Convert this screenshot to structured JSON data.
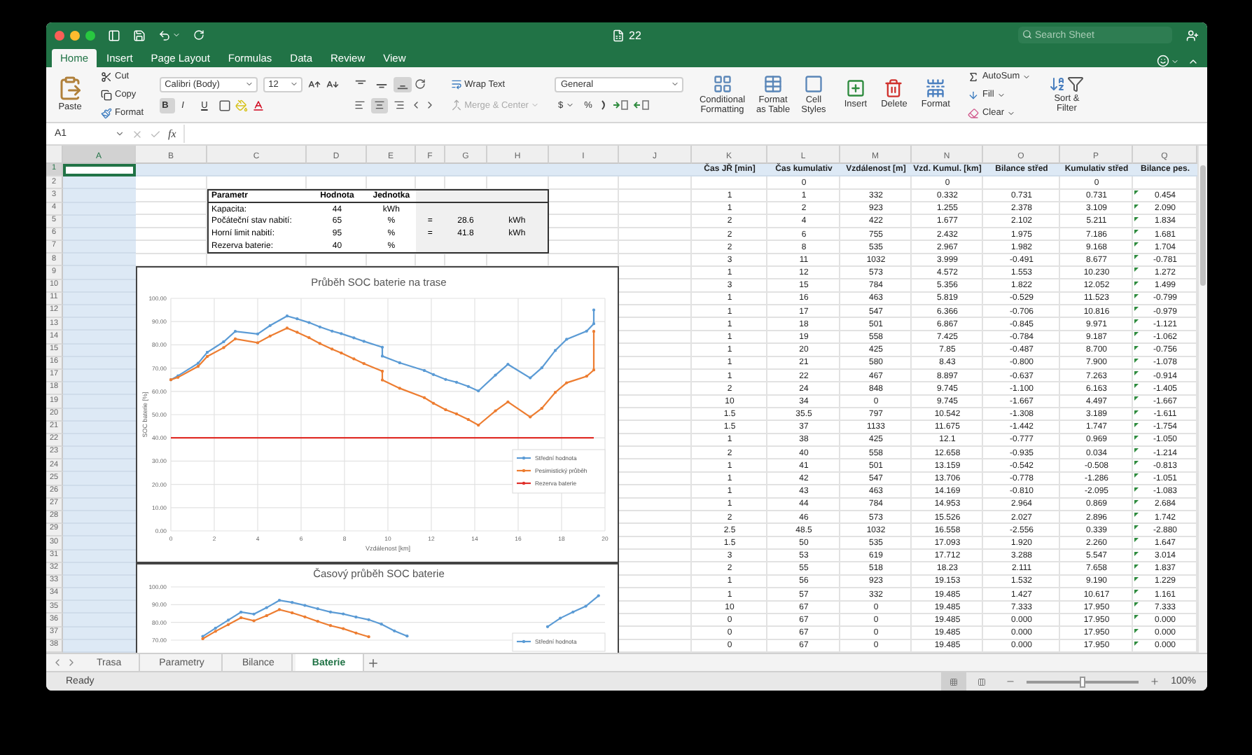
{
  "window": {
    "title": "22",
    "search": {
      "placeholder": "Search Sheet"
    }
  },
  "ribbon_tabs": [
    {
      "label": "Home",
      "selected": true
    },
    {
      "label": "Insert",
      "selected": false
    },
    {
      "label": "Page Layout",
      "selected": false
    },
    {
      "label": "Formulas",
      "selected": false
    },
    {
      "label": "Data",
      "selected": false
    },
    {
      "label": "Review",
      "selected": false
    },
    {
      "label": "View",
      "selected": false
    }
  ],
  "clipboard": {
    "paste": "Paste",
    "cut": "Cut",
    "copy": "Copy",
    "format": "Format"
  },
  "font": {
    "name": "Calibri (Body)",
    "size": "12",
    "styles": [
      {
        "kind": "bold",
        "label": "B",
        "pressed": true
      },
      {
        "kind": "italic",
        "label": "I",
        "pressed": false
      },
      {
        "kind": "underline",
        "label": "U",
        "pressed": false
      }
    ]
  },
  "alignment": {
    "vertical": [
      {
        "kind": "top",
        "selected": false
      },
      {
        "kind": "middle",
        "selected": false
      },
      {
        "kind": "bottom",
        "selected": true
      }
    ],
    "horizontal": [
      {
        "kind": "left",
        "selected": false
      },
      {
        "kind": "center",
        "selected": true
      },
      {
        "kind": "right",
        "selected": false
      }
    ],
    "wrap_text": "Wrap Text",
    "merge": {
      "label": "Merge & Center",
      "disabled": true
    }
  },
  "number": {
    "format": "General",
    "currency": "$",
    "percent": "%"
  },
  "styles": [
    {
      "kind": "conditional",
      "lines": [
        "Conditional",
        "Formatting"
      ]
    },
    {
      "kind": "table",
      "lines": [
        "Format",
        "as Table"
      ]
    },
    {
      "kind": "cell",
      "lines": [
        "Cell",
        "Styles"
      ]
    }
  ],
  "cells": [
    {
      "kind": "insert",
      "label": "Insert"
    },
    {
      "kind": "delete",
      "label": "Delete"
    },
    {
      "kind": "format",
      "label": "Format"
    }
  ],
  "editing": {
    "autosum": "AutoSum",
    "fill": "Fill",
    "clear": "Clear",
    "sort": [
      "Sort &",
      "Filter"
    ]
  },
  "formula_bar": {
    "name_box": "A1",
    "function_label": "fx"
  },
  "columns": [
    {
      "label": "A",
      "selected": true
    },
    {
      "label": "B",
      "selected": false
    },
    {
      "label": "C",
      "selected": false
    },
    {
      "label": "D",
      "selected": false
    },
    {
      "label": "E",
      "selected": false
    },
    {
      "label": "F",
      "selected": false
    },
    {
      "label": "G",
      "selected": false
    },
    {
      "label": "H",
      "selected": false
    },
    {
      "label": "I",
      "selected": false
    },
    {
      "label": "J",
      "selected": false
    },
    {
      "label": "K",
      "selected": false
    },
    {
      "label": "L",
      "selected": false
    },
    {
      "label": "M",
      "selected": false
    },
    {
      "label": "N",
      "selected": false
    },
    {
      "label": "O",
      "selected": false
    },
    {
      "label": "P",
      "selected": false
    },
    {
      "label": "Q",
      "selected": false
    }
  ],
  "row_headers": [
    {
      "label": "1",
      "selected": true
    },
    {
      "label": "2",
      "selected": false
    },
    {
      "label": "3",
      "selected": false
    },
    {
      "label": "4",
      "selected": false
    },
    {
      "label": "5",
      "selected": false
    },
    {
      "label": "6",
      "selected": false
    },
    {
      "label": "7",
      "selected": false
    },
    {
      "label": "8",
      "selected": false
    },
    {
      "label": "9",
      "selected": false
    },
    {
      "label": "10",
      "selected": false
    },
    {
      "label": "11",
      "selected": false
    },
    {
      "label": "12",
      "selected": false
    },
    {
      "label": "13",
      "selected": false
    },
    {
      "label": "14",
      "selected": false
    },
    {
      "label": "15",
      "selected": false
    },
    {
      "label": "16",
      "selected": false
    },
    {
      "label": "17",
      "selected": false
    },
    {
      "label": "18",
      "selected": false
    },
    {
      "label": "19",
      "selected": false
    },
    {
      "label": "20",
      "selected": false
    },
    {
      "label": "21",
      "selected": false
    },
    {
      "label": "22",
      "selected": false
    },
    {
      "label": "23",
      "selected": false
    },
    {
      "label": "24",
      "selected": false
    },
    {
      "label": "25",
      "selected": false
    },
    {
      "label": "26",
      "selected": false
    },
    {
      "label": "27",
      "selected": false
    },
    {
      "label": "28",
      "selected": false
    },
    {
      "label": "29",
      "selected": false
    },
    {
      "label": "30",
      "selected": false
    },
    {
      "label": "31",
      "selected": false
    },
    {
      "label": "32",
      "selected": false
    },
    {
      "label": "33",
      "selected": false
    },
    {
      "label": "34",
      "selected": false
    },
    {
      "label": "35",
      "selected": false
    },
    {
      "label": "36",
      "selected": false
    },
    {
      "label": "37",
      "selected": false
    },
    {
      "label": "38",
      "selected": false
    }
  ],
  "parameters": {
    "header": [
      "Parametr",
      "Hodnota",
      "Jednotka"
    ],
    "rows": [
      [
        "Kapacita:",
        "44",
        "kWh",
        null,
        null,
        null
      ],
      [
        "Počáteční stav nabití:",
        "65",
        "%",
        "=",
        "28.6",
        "kWh"
      ],
      [
        "Horní limit nabití:",
        "95",
        "%",
        "=",
        "41.8",
        "kWh"
      ],
      [
        "Rezerva baterie:",
        "40",
        "%",
        null,
        null,
        null
      ]
    ]
  },
  "charts": [
    {
      "chart_data": {
        "type": "line",
        "title": "Průběh SOC baterie na trase",
        "xlabel": "Vzdálenost [km]",
        "ylabel": "SOC baterie [%]",
        "x": [
          0,
          0.332,
          1.255,
          1.677,
          2.432,
          2.967,
          3.999,
          4.572,
          5.356,
          5.819,
          6.366,
          6.867,
          7.425,
          7.85,
          8.43,
          8.897,
          9.745,
          9.745,
          10.542,
          11.675,
          12.1,
          12.658,
          13.159,
          13.706,
          14.169,
          14.953,
          15.526,
          16.558,
          17.093,
          17.712,
          18.23,
          19.153,
          19.485,
          19.485
        ],
        "xlim": [
          0,
          20
        ],
        "ylim": [
          0,
          100
        ],
        "grid": true,
        "legend": "right",
        "xticks": [
          0,
          2,
          4,
          6,
          8,
          10,
          12,
          14,
          16,
          18,
          20
        ],
        "yticks": [
          {
            "value": 0,
            "label": "0.00"
          },
          {
            "value": 10,
            "label": "10.00"
          },
          {
            "value": 20,
            "label": "20.00"
          },
          {
            "value": 30,
            "label": "30.00"
          },
          {
            "value": 40,
            "label": "40.00"
          },
          {
            "value": 50,
            "label": "50.00"
          },
          {
            "value": 60,
            "label": "60.00"
          },
          {
            "value": 70,
            "label": "70.00"
          },
          {
            "value": 80,
            "label": "80.00"
          },
          {
            "value": 90,
            "label": "90.00"
          },
          {
            "value": 100,
            "label": "100.00"
          }
        ],
        "series": [
          {
            "name": "Střední hodnota",
            "color": "#5b9bd5",
            "values": [
              65,
              66.7,
              72.1,
              76.8,
              81.3,
              85.8,
              84.7,
              88.3,
              92.4,
              91.2,
              89.6,
              87.7,
              85.9,
              84.8,
              83,
              81.5,
              79,
              75.2,
              72.3,
              69,
              67.2,
              65.1,
              63.9,
              62.1,
              60.2,
              67,
              71.6,
              65.8,
              70.1,
              77.6,
              82.4,
              85.9,
              89.1,
              95
            ]
          },
          {
            "name": "Pesimistický průběh",
            "color": "#ed7d31",
            "values": [
              65,
              66,
              70.8,
              75,
              78.8,
              82.6,
              80.9,
              83.8,
              87.2,
              85.4,
              83.1,
              80.6,
              78.2,
              76.5,
              74,
              71.9,
              68.7,
              64.9,
              61.3,
              57.3,
              54.9,
              52.1,
              50.3,
              47.9,
              45.5,
              51.6,
              55.5,
              49,
              52.7,
              59.6,
              63.7,
              66.5,
              69.2,
              85.8
            ]
          },
          {
            "name": "Rezerva baterie",
            "color": "#e0302a",
            "values": [
              40,
              40,
              40,
              40,
              40,
              40,
              40,
              40,
              40,
              40,
              40,
              40,
              40,
              40,
              40,
              40,
              40,
              40,
              40,
              40,
              40,
              40,
              40,
              40,
              40,
              40,
              40,
              40,
              40,
              40,
              40,
              40,
              40,
              40
            ]
          }
        ]
      }
    },
    {
      "chart_data": {
        "type": "line",
        "title": "Časový průběh SOC baterie",
        "categories": [
          null,
          null,
          null,
          null,
          null,
          null,
          null,
          null,
          null,
          null,
          null,
          null,
          null,
          null,
          null,
          null,
          null,
          null,
          null,
          null,
          null,
          null,
          null,
          null,
          null,
          null,
          null,
          null,
          null,
          null,
          null,
          null,
          null,
          null
        ],
        "ylim": [
          70,
          100
        ],
        "grid": true,
        "legend": "right",
        "yticks": [
          {
            "value": 70,
            "label": "70.00"
          },
          {
            "value": 80,
            "label": "80.00"
          },
          {
            "value": 90,
            "label": "90.00"
          },
          {
            "value": 100,
            "label": "100.00"
          }
        ],
        "series": [
          {
            "name": "Střední hodnota",
            "color": "#5b9bd5",
            "values": [
              null,
              null,
              72.1,
              76.8,
              81.3,
              85.8,
              84.7,
              88.3,
              92.4,
              91.2,
              89.6,
              87.7,
              85.9,
              84.8,
              83,
              81.5,
              79,
              75.2,
              72.3,
              null,
              null,
              null,
              null,
              null,
              null,
              null,
              null,
              null,
              null,
              77.6,
              82.4,
              85.9,
              89.1,
              95
            ]
          },
          {
            "color": "#ed7d31",
            "values": [
              null,
              null,
              70.8,
              75,
              78.8,
              82.6,
              80.9,
              83.8,
              87.2,
              85.4,
              83.1,
              80.6,
              78.2,
              76.5,
              74,
              71.9,
              null,
              null,
              null,
              null,
              null,
              null,
              null,
              null,
              null,
              null,
              null,
              null,
              null,
              null,
              null,
              null,
              null,
              null
            ]
          }
        ]
      }
    }
  ],
  "data_table": {
    "header": [
      "Čas JŘ [min]",
      "Čas kumulativ",
      "Vzdálenost [m]",
      "Vzd. Kumul. [km]",
      "Bilance střed",
      "Kumulativ střed",
      "Bilance pes."
    ],
    "rows": [
      [
        null,
        "0",
        null,
        "0",
        null,
        "0",
        null
      ],
      [
        "1",
        "1",
        "332",
        "0.332",
        "0.731",
        "0.731",
        "0.454"
      ],
      [
        "1",
        "2",
        "923",
        "1.255",
        "2.378",
        "3.109",
        "2.090"
      ],
      [
        "2",
        "4",
        "422",
        "1.677",
        "2.102",
        "5.211",
        "1.834"
      ],
      [
        "2",
        "6",
        "755",
        "2.432",
        "1.975",
        "7.186",
        "1.681"
      ],
      [
        "2",
        "8",
        "535",
        "2.967",
        "1.982",
        "9.168",
        "1.704"
      ],
      [
        "3",
        "11",
        "1032",
        "3.999",
        "-0.491",
        "8.677",
        "-0.781"
      ],
      [
        "1",
        "12",
        "573",
        "4.572",
        "1.553",
        "10.230",
        "1.272"
      ],
      [
        "3",
        "15",
        "784",
        "5.356",
        "1.822",
        "12.052",
        "1.499"
      ],
      [
        "1",
        "16",
        "463",
        "5.819",
        "-0.529",
        "11.523",
        "-0.799"
      ],
      [
        "1",
        "17",
        "547",
        "6.366",
        "-0.706",
        "10.816",
        "-0.979"
      ],
      [
        "1",
        "18",
        "501",
        "6.867",
        "-0.845",
        "9.971",
        "-1.121"
      ],
      [
        "1",
        "19",
        "558",
        "7.425",
        "-0.784",
        "9.187",
        "-1.062"
      ],
      [
        "1",
        "20",
        "425",
        "7.85",
        "-0.487",
        "8.700",
        "-0.756"
      ],
      [
        "1",
        "21",
        "580",
        "8.43",
        "-0.800",
        "7.900",
        "-1.078"
      ],
      [
        "1",
        "22",
        "467",
        "8.897",
        "-0.637",
        "7.263",
        "-0.914"
      ],
      [
        "2",
        "24",
        "848",
        "9.745",
        "-1.100",
        "6.163",
        "-1.405"
      ],
      [
        "10",
        "34",
        "0",
        "9.745",
        "-1.667",
        "4.497",
        "-1.667"
      ],
      [
        "1.5",
        "35.5",
        "797",
        "10.542",
        "-1.308",
        "3.189",
        "-1.611"
      ],
      [
        "1.5",
        "37",
        "1133",
        "11.675",
        "-1.442",
        "1.747",
        "-1.754"
      ],
      [
        "1",
        "38",
        "425",
        "12.1",
        "-0.777",
        "0.969",
        "-1.050"
      ],
      [
        "2",
        "40",
        "558",
        "12.658",
        "-0.935",
        "0.034",
        "-1.214"
      ],
      [
        "1",
        "41",
        "501",
        "13.159",
        "-0.542",
        "-0.508",
        "-0.813"
      ],
      [
        "1",
        "42",
        "547",
        "13.706",
        "-0.778",
        "-1.286",
        "-1.051"
      ],
      [
        "1",
        "43",
        "463",
        "14.169",
        "-0.810",
        "-2.095",
        "-1.083"
      ],
      [
        "1",
        "44",
        "784",
        "14.953",
        "2.964",
        "0.869",
        "2.684"
      ],
      [
        "2",
        "46",
        "573",
        "15.526",
        "2.027",
        "2.896",
        "1.742"
      ],
      [
        "2.5",
        "48.5",
        "1032",
        "16.558",
        "-2.556",
        "0.339",
        "-2.880"
      ],
      [
        "1.5",
        "50",
        "535",
        "17.093",
        "1.920",
        "2.260",
        "1.647"
      ],
      [
        "3",
        "53",
        "619",
        "17.712",
        "3.288",
        "5.547",
        "3.014"
      ],
      [
        "2",
        "55",
        "518",
        "18.23",
        "2.111",
        "7.658",
        "1.837"
      ],
      [
        "1",
        "56",
        "923",
        "19.153",
        "1.532",
        "9.190",
        "1.229"
      ],
      [
        "1",
        "57",
        "332",
        "19.485",
        "1.427",
        "10.617",
        "1.161"
      ],
      [
        "10",
        "67",
        "0",
        "19.485",
        "7.333",
        "17.950",
        "7.333"
      ],
      [
        "0",
        "67",
        "0",
        "19.485",
        "0.000",
        "17.950",
        "0.000"
      ],
      [
        "0",
        "67",
        "0",
        "19.485",
        "0.000",
        "17.950",
        "0.000"
      ],
      [
        "0",
        "67",
        "0",
        "19.485",
        "0.000",
        "17.950",
        "0.000"
      ]
    ]
  },
  "sheet_tabs": [
    {
      "label": "Trasa",
      "selected": false
    },
    {
      "label": "Parametry",
      "selected": false
    },
    {
      "label": "Bilance",
      "selected": false
    },
    {
      "label": "Baterie",
      "selected": true
    }
  ],
  "status_bar": {
    "status": "Ready",
    "views": [
      {
        "kind": "normal",
        "selected": true
      },
      {
        "kind": "page_layout",
        "selected": false
      }
    ],
    "zoom": {
      "level": 0.5,
      "label": "100%"
    }
  }
}
